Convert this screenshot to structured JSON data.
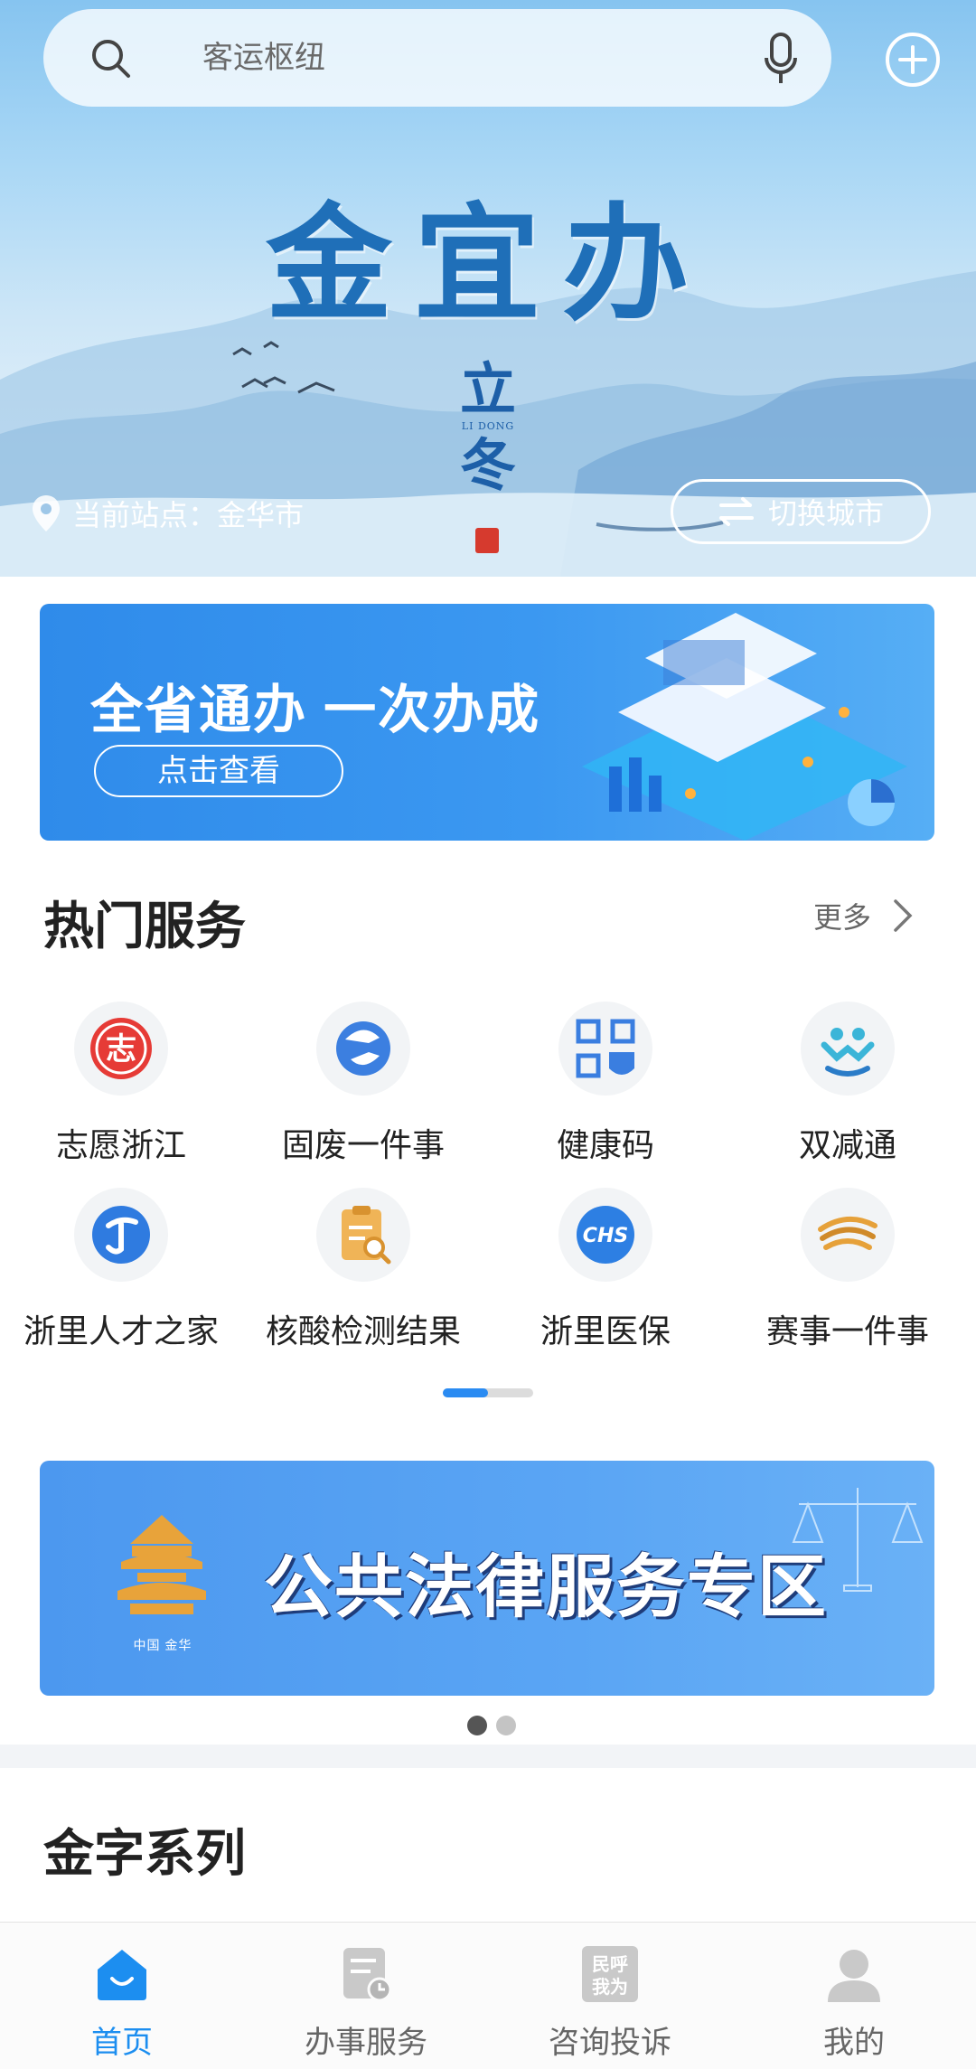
{
  "search": {
    "placeholder": "客运枢纽"
  },
  "hero": {
    "title": "金宜办",
    "solar_term_char1": "立",
    "solar_term_pinyin": "LI DONG",
    "solar_term_char2": "冬",
    "station_text": "当前站点：金华市",
    "switch_city_label": "切换城市"
  },
  "banner1": {
    "title": "全省通办 一次办成",
    "button_label": "点击查看"
  },
  "hot_services": {
    "title": "热门服务",
    "more_label": "更多",
    "items": [
      {
        "label": "志愿浙江",
        "icon": "volunteer-icon"
      },
      {
        "label": "固废一件事",
        "icon": "solid-waste-icon"
      },
      {
        "label": "健康码",
        "icon": "health-code-icon"
      },
      {
        "label": "双减通",
        "icon": "double-reduction-icon"
      },
      {
        "label": "浙里人才之家",
        "icon": "talent-home-icon"
      },
      {
        "label": "核酸检测结果",
        "icon": "nucleic-test-icon"
      },
      {
        "label": "浙里医保",
        "icon": "medical-insurance-icon"
      },
      {
        "label": "赛事一件事",
        "icon": "sports-event-icon"
      }
    ],
    "page_indicator": {
      "current": 1,
      "total": 2
    }
  },
  "banner2": {
    "title": "公共法律服务专区",
    "logo_caption": "中国 金华",
    "carousel": {
      "current": 1,
      "total": 2
    }
  },
  "jin_series": {
    "title": "金字系列"
  },
  "tabbar": {
    "items": [
      {
        "label": "首页",
        "icon": "home-icon",
        "active": true
      },
      {
        "label": "办事服务",
        "icon": "service-doc-icon",
        "active": false
      },
      {
        "label": "咨询投诉",
        "icon": "complaint-icon",
        "active": false
      },
      {
        "label": "我的",
        "icon": "profile-icon",
        "active": false
      }
    ],
    "complaint_icon_text": "民呼我为"
  },
  "colors": {
    "accent": "#1c8ef0",
    "hero_title": "#1f6fb8",
    "banner_blue": "#3b98f1"
  }
}
